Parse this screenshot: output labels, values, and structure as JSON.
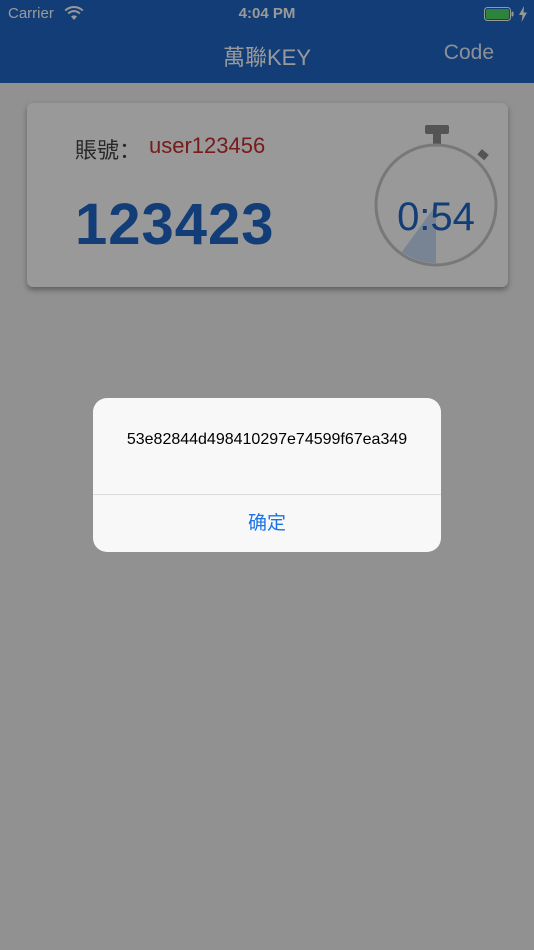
{
  "status_bar": {
    "carrier": "Carrier",
    "time": "4:04 PM",
    "icons": [
      "wifi-icon",
      "battery-icon",
      "charging-icon"
    ]
  },
  "nav": {
    "title": "萬聯KEY",
    "right_button": "Code"
  },
  "card": {
    "account_label": "賬號：",
    "account_value": "user123456",
    "otp_code": "123423",
    "timer_text": "0:54",
    "timer_progress": 0.1,
    "timer_icon": "stopwatch-icon"
  },
  "alert": {
    "message": "53e82844d498410297e74599f67ea349",
    "button_label": "确定"
  },
  "colors": {
    "brand_blue": "#1f66c7",
    "account_red": "#c62d2d",
    "alert_button_blue": "#1a73e8",
    "overlay": "rgba(0,0,0,0.4)"
  }
}
